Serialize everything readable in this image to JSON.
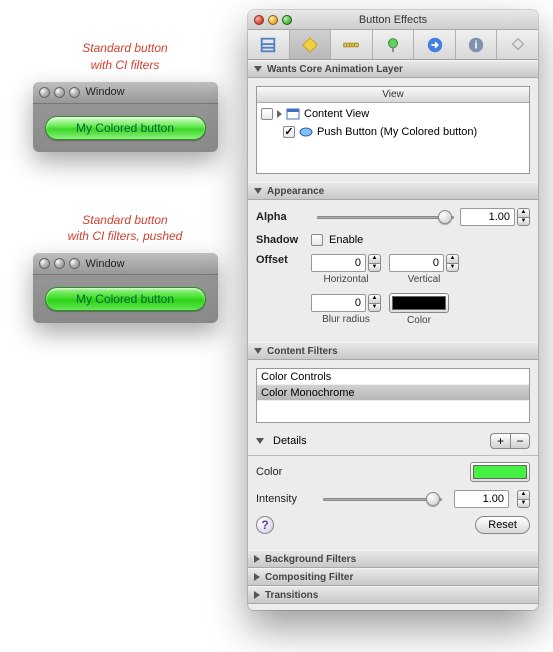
{
  "demo": {
    "caption1_line1": "Standard button",
    "caption1_line2": "with CI filters",
    "caption2_line1": "Standard button",
    "caption2_line2": "with CI filters, pushed",
    "window_title": "Window",
    "button_label": "My Colored button"
  },
  "inspector": {
    "title": "Button Effects",
    "sections": {
      "core_anim": "Wants Core Animation Layer",
      "appearance": "Appearance",
      "content_filters": "Content Filters",
      "details": "Details",
      "background_filters": "Background Filters",
      "compositing": "Compositing Filter",
      "transitions": "Transitions"
    },
    "outline": {
      "column": "View",
      "row1": "Content View",
      "row2": "Push Button (My Colored button)"
    },
    "appearance": {
      "alpha_label": "Alpha",
      "alpha_value": "1.00",
      "shadow_label": "Shadow",
      "enable_label": "Enable",
      "offset_label": "Offset",
      "horizontal_label": "Horizontal",
      "horizontal_value": "0",
      "vertical_label": "Vertical",
      "vertical_value": "0",
      "blur_label": "Blur radius",
      "blur_value": "0",
      "color_label": "Color",
      "shadow_color": "#000000"
    },
    "filters": {
      "item1": "Color Controls",
      "item2": "Color Monochrome"
    },
    "details": {
      "color_label": "Color",
      "color_value": "#45f043",
      "intensity_label": "Intensity",
      "intensity_value": "1.00",
      "reset_label": "Reset",
      "plus": "+",
      "minus": "−"
    }
  }
}
